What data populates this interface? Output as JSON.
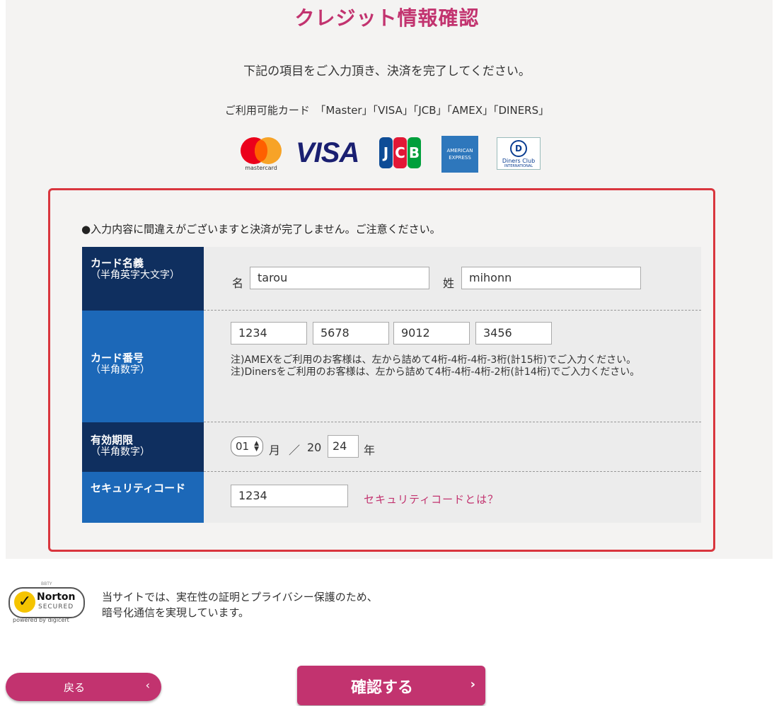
{
  "page": {
    "title": "クレジット情報確認",
    "lead": "下記の項目をご入力頂き、決済を完了してください。",
    "available_cards": "ご利用可能カード　「Master」「VISA」「JCB」「AMEX」「DINERS」"
  },
  "card_logos": {
    "mastercard": "mastercard",
    "visa": "VISA",
    "jcb": [
      "J",
      "C",
      "B"
    ],
    "amex": "AMERICAN EXPRESS",
    "diners": "Diners Club",
    "diners_sub": "INTERNATIONAL"
  },
  "form": {
    "notice": "●入力内容に間違えがございますと決済が完了しません。ご注意ください。",
    "name": {
      "label": "カード名義",
      "sub": "（半角英字大文字）",
      "first_label": "名",
      "first_value": "tarou",
      "last_label": "姓",
      "last_value": "mihonn"
    },
    "number": {
      "label": "カード番号",
      "sub": "（半角数字）",
      "parts": [
        "1234",
        "5678",
        "9012",
        "3456"
      ],
      "note1": "注)AMEXをご利用のお客様は、左から詰めて4桁-4桁-4桁-3桁(計15桁)でご入力ください。",
      "note2": "注)Dinersをご利用のお客様は、左から詰めて4桁-4桁-4桁-2桁(計14桁)でご入力ください。"
    },
    "expiry": {
      "label": "有効期限",
      "sub": "（半角数字）",
      "month": "01",
      "month_unit": "月",
      "separator": "／",
      "year_prefix": "20",
      "year": "24",
      "year_unit": "年"
    },
    "security": {
      "label": "セキュリティコード",
      "value": "1234",
      "help_link": "セキュリティコードとは？"
    }
  },
  "ssl": {
    "badge_name": "Norton",
    "badge_secured": "SECURED",
    "badge_by": "powered by digicert",
    "line1": "当サイトでは、実在性の証明とプライバシー保護のため、",
    "line2": "暗号化通信を実現しています。"
  },
  "buttons": {
    "back": "戻る",
    "confirm": "確認する"
  },
  "colors": {
    "accent": "#c2336f",
    "navy": "#0f2f5f",
    "blue": "#1c68b8",
    "frame": "#d9363e"
  }
}
